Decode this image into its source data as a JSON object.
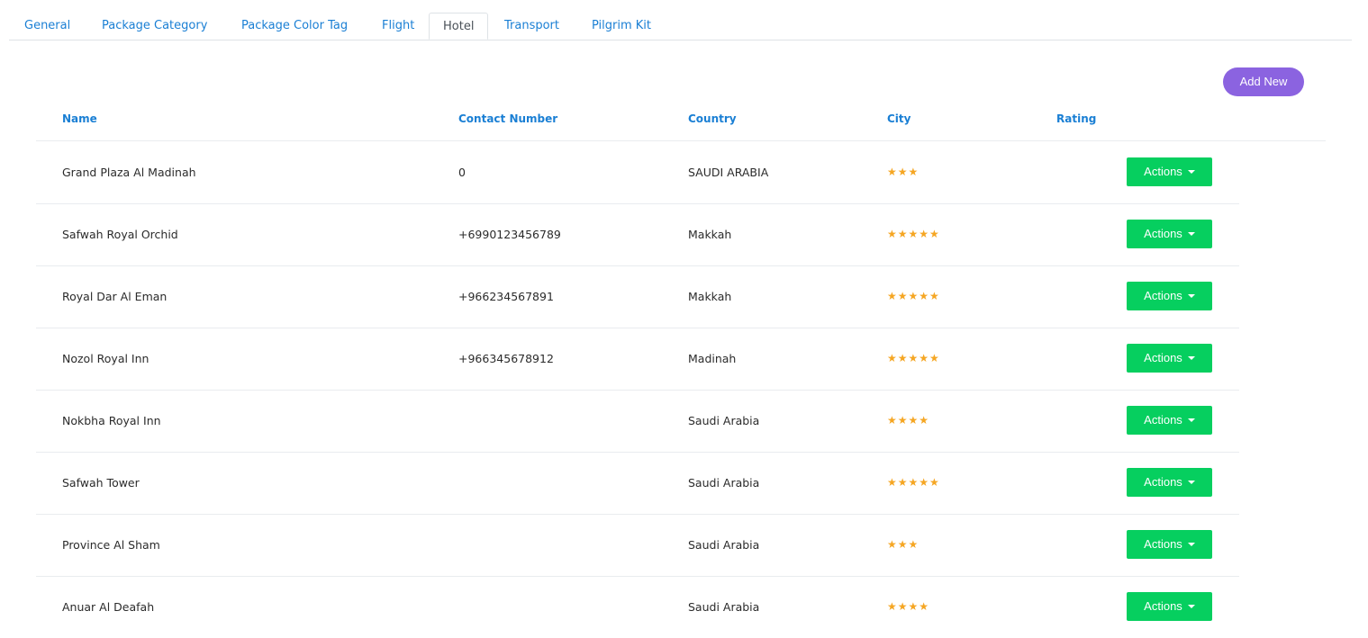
{
  "tabs": [
    {
      "label": "General",
      "active": false
    },
    {
      "label": "Package Category",
      "active": false
    },
    {
      "label": "Package Color Tag",
      "active": false
    },
    {
      "label": "Flight",
      "active": false
    },
    {
      "label": "Hotel",
      "active": true
    },
    {
      "label": "Transport",
      "active": false
    },
    {
      "label": "Pilgrim Kit",
      "active": false
    }
  ],
  "toolbar": {
    "add_new_label": "Add New"
  },
  "table": {
    "columns": [
      "Name",
      "Contact Number",
      "Country",
      "City",
      "Rating"
    ],
    "action_label": "Actions",
    "rows": [
      {
        "name": "Grand Plaza Al Madinah",
        "contact": "0",
        "country": "SAUDI ARABIA",
        "stars": "★★★",
        "rating": 3
      },
      {
        "name": "Safwah Royal Orchid",
        "contact": "+6990123456789",
        "country": "Makkah",
        "stars": "★★★★★",
        "rating": 5
      },
      {
        "name": "Royal Dar Al Eman",
        "contact": "+966234567891",
        "country": "Makkah",
        "stars": "★★★★★",
        "rating": 5
      },
      {
        "name": "Nozol Royal Inn",
        "contact": "+966345678912",
        "country": "Madinah",
        "stars": "★★★★★",
        "rating": 5
      },
      {
        "name": "Nokbha Royal Inn",
        "contact": "",
        "country": "Saudi Arabia",
        "stars": "★★★★",
        "rating": 4
      },
      {
        "name": "Safwah Tower",
        "contact": "",
        "country": "Saudi Arabia",
        "stars": "★★★★★",
        "rating": 5
      },
      {
        "name": "Province Al Sham",
        "contact": "",
        "country": "Saudi Arabia",
        "stars": "★★★",
        "rating": 3
      },
      {
        "name": "Anuar Al Deafah",
        "contact": "",
        "country": "Saudi Arabia",
        "stars": "★★★★",
        "rating": 4
      }
    ]
  },
  "colors": {
    "link": "#1a7fd4",
    "add_new": "#8b63e0",
    "actions": "#06cf5f",
    "star": "#f5a623"
  },
  "icons": {
    "rating": "star-icon",
    "dropdown": "caret-down-icon"
  }
}
